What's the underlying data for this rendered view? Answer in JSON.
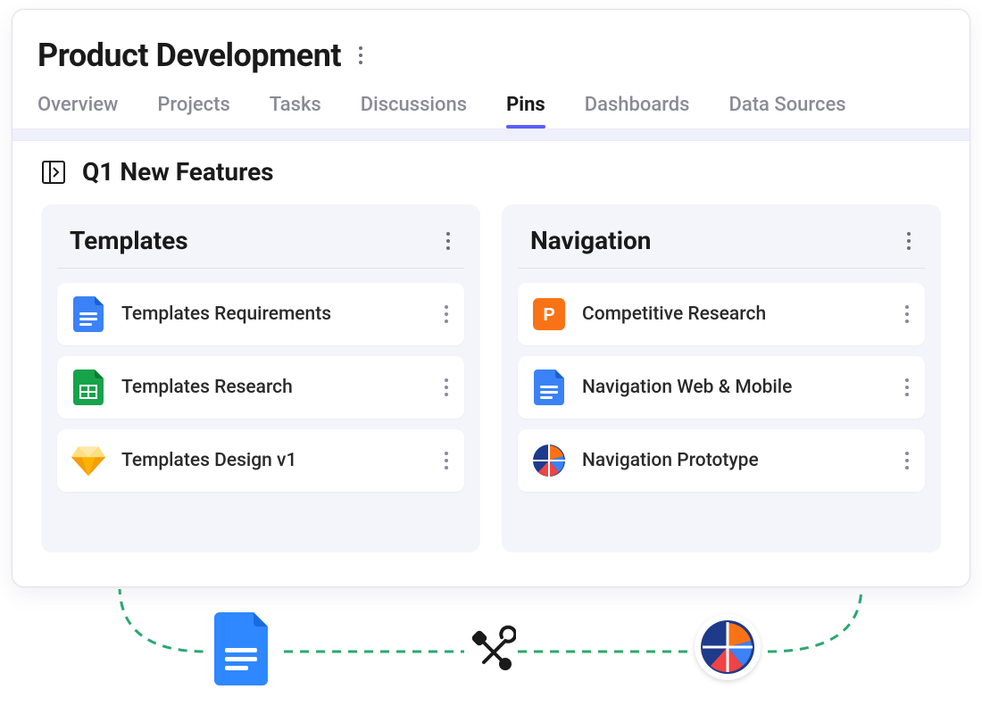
{
  "page": {
    "title": "Product Development"
  },
  "tabs": [
    {
      "label": "Overview",
      "active": false
    },
    {
      "label": "Projects",
      "active": false
    },
    {
      "label": "Tasks",
      "active": false
    },
    {
      "label": "Discussions",
      "active": false
    },
    {
      "label": "Pins",
      "active": true
    },
    {
      "label": "Dashboards",
      "active": false
    },
    {
      "label": "Data Sources",
      "active": false
    }
  ],
  "section": {
    "title": "Q1 New Features"
  },
  "columns": [
    {
      "title": "Templates",
      "cards": [
        {
          "icon": "google-doc",
          "label": "Templates Requirements"
        },
        {
          "icon": "google-sheet",
          "label": "Templates Research"
        },
        {
          "icon": "sketch",
          "label": "Templates Design v1"
        }
      ]
    },
    {
      "title": "Navigation",
      "cards": [
        {
          "icon": "powerpoint",
          "label": "Competitive Research"
        },
        {
          "icon": "google-doc",
          "label": "Navigation Web & Mobile"
        },
        {
          "icon": "pie-app",
          "label": "Navigation Prototype"
        }
      ]
    }
  ],
  "icon_colors": {
    "google-doc": "#3b82f6",
    "google-sheet": "#16a34a",
    "sketch": "#f59e0b",
    "powerpoint": "#f97316",
    "pie-app": "#1e3a8a"
  }
}
